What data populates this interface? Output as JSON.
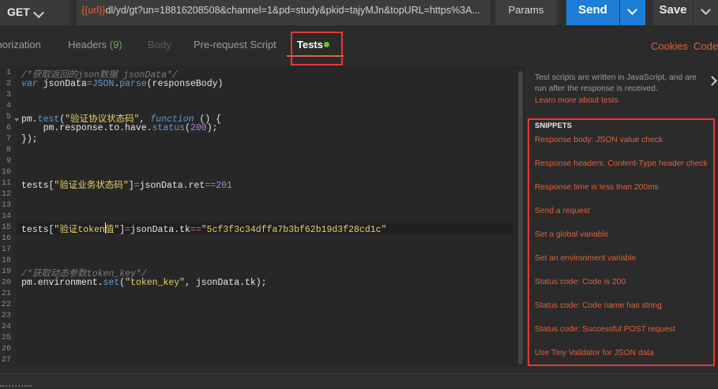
{
  "request": {
    "method": "GET",
    "url_variable": "{{url}}",
    "url_rest": "dl/yd/gt?un=18816208508&channel=1&pd=study&pkid=tajyMJn&topURL=https%3A...",
    "params_label": "Params",
    "send_label": "Send",
    "save_label": "Save"
  },
  "tabs": {
    "authorization": "Authorization",
    "headers": "Headers",
    "headers_count": "(9)",
    "body": "Body",
    "prerequest": "Pre-request Script",
    "tests": "Tests"
  },
  "links": {
    "cookies": "Cookies",
    "code": "Code"
  },
  "editor": {
    "line_numbers": [
      "1",
      "2",
      "3",
      "4",
      "5",
      "6",
      "7",
      "8",
      "9",
      "10",
      "11",
      "12",
      "13",
      "14",
      "15",
      "16",
      "17",
      "18",
      "19",
      "20",
      "21",
      "22",
      "23",
      "24",
      "25",
      "26",
      "27"
    ],
    "comment1": "/*获取返回的json数据 jsonData*/",
    "comment2": "/*获取动态参数token_key*/",
    "string_status": "\"验证协议状态码\"",
    "string_biz": "\"验证业务状态码\"",
    "string_token": "\"验证token值\"",
    "string_tk": "\"5cf3f3c34dffa7b3bf62b19d3f28cd1c\"",
    "string_tokenkey": "\"token_key\"",
    "num_200": "200",
    "num_201": "201"
  },
  "panel": {
    "description": "Test scripts are written in JavaScript, and are run after the response is received.",
    "learn_more": "Learn more about tests",
    "snippets_title": "SNIPPETS",
    "snippets": [
      "Response body: JSON value check",
      "Response headers: Content-Type header check",
      "Response time is less than 200ms",
      "Send a request",
      "Set a global variable",
      "Set an environment variable",
      "Status code: Code is 200",
      "Status code: Code name has string",
      "Status code: Successful POST request",
      "Use Tiny Validator for JSON data"
    ]
  },
  "colors": {
    "accent": "#e0613b",
    "send_blue": "#1c7ed6",
    "highlight_red": "#e53935",
    "status_green": "#6abf2c"
  }
}
